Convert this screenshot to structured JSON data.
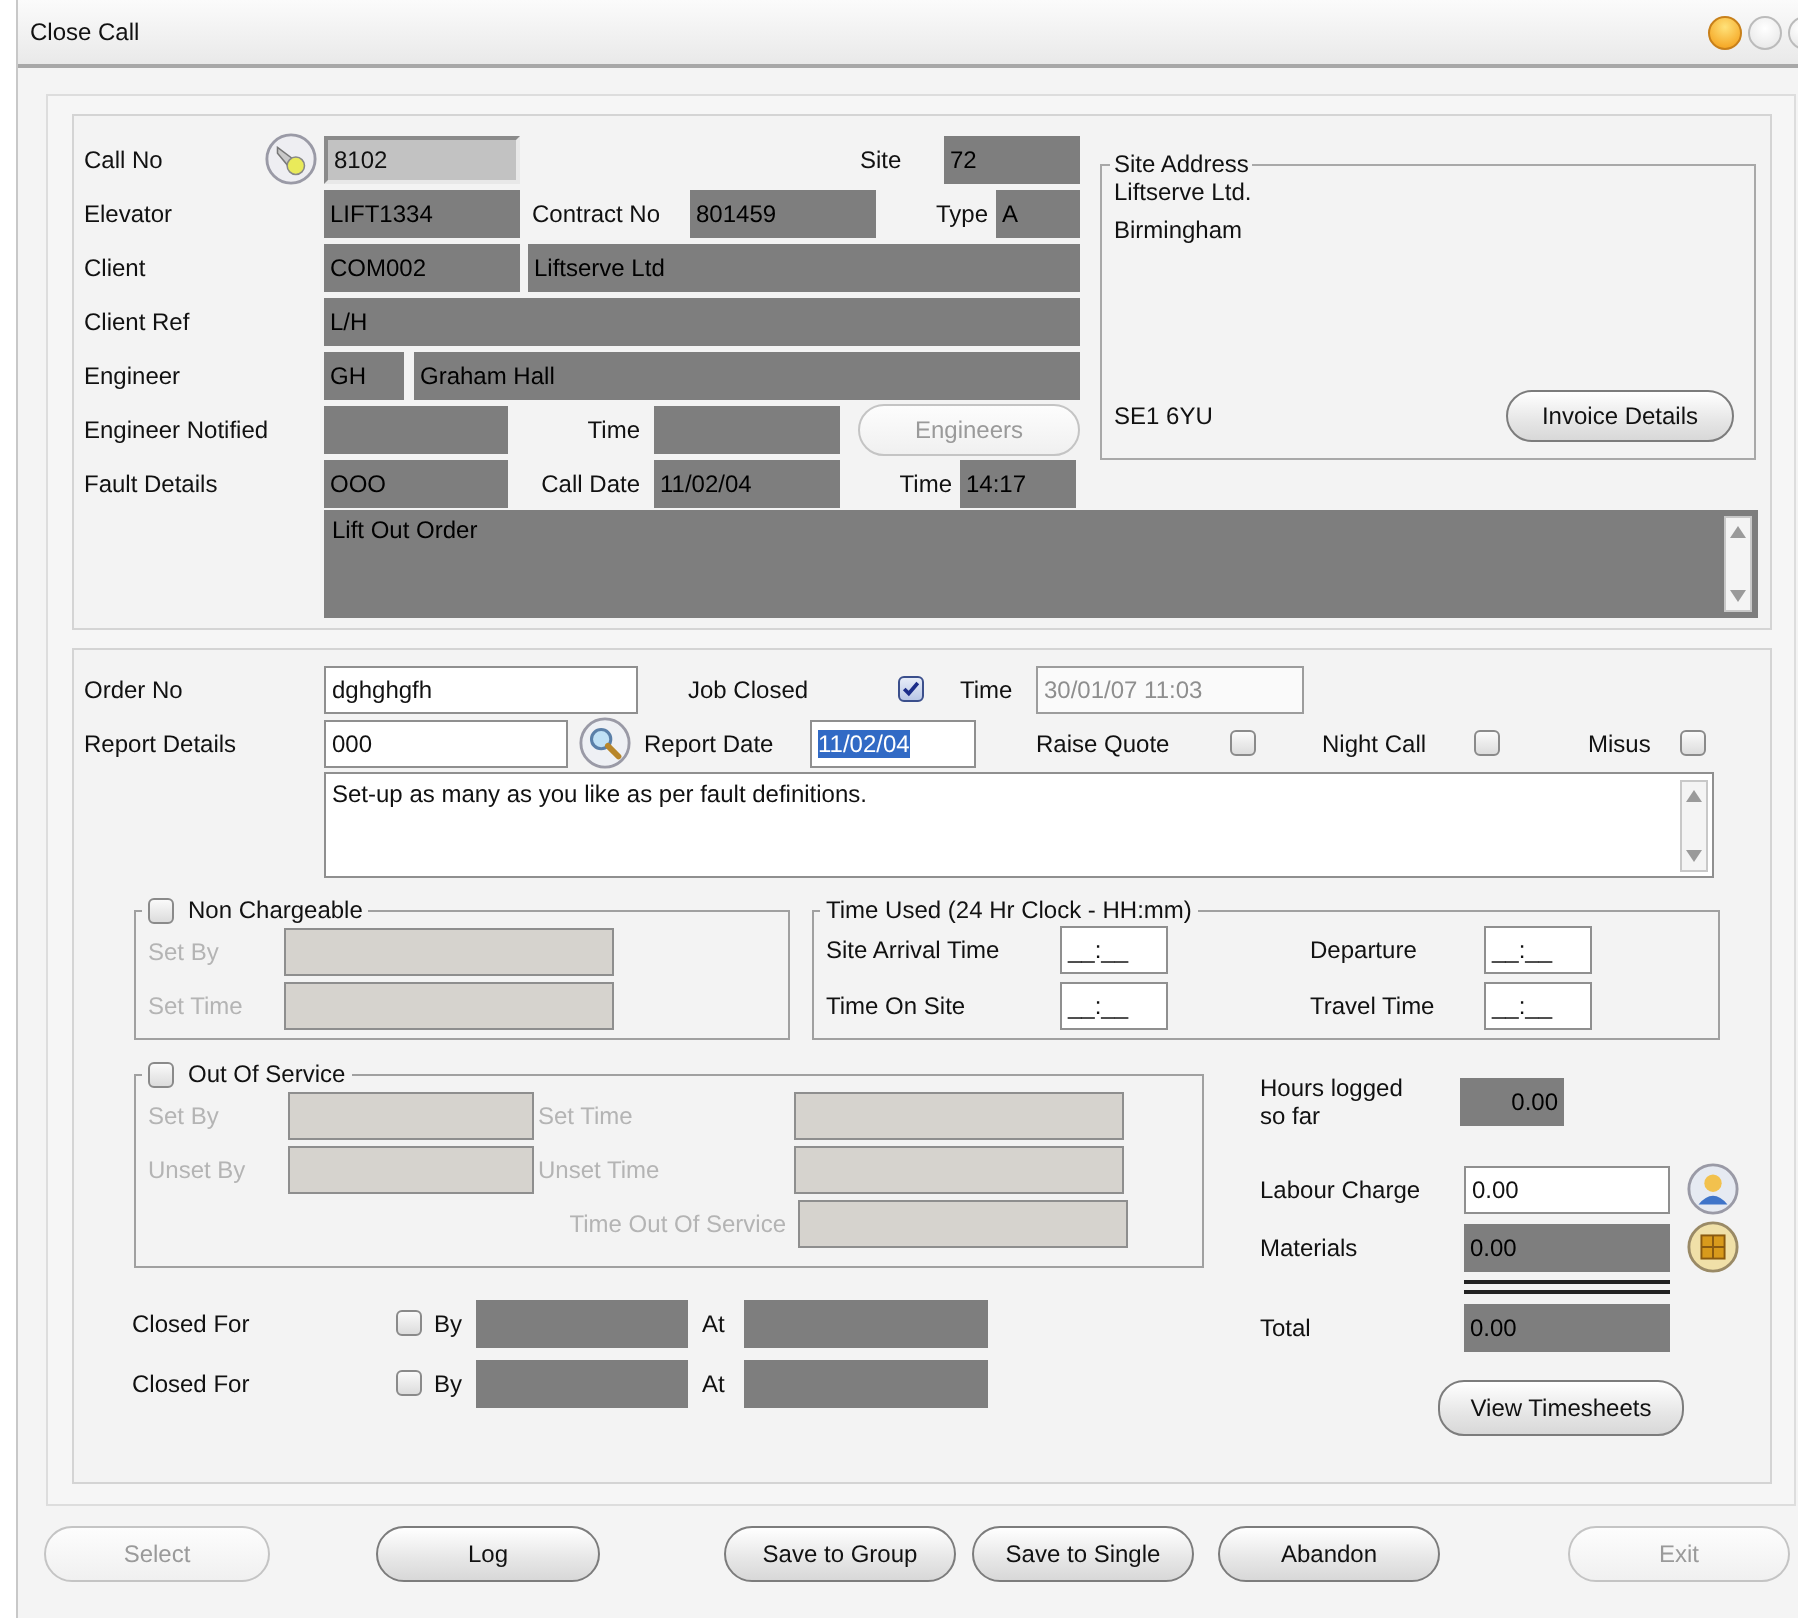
{
  "window": {
    "title": "Close Call"
  },
  "call": {
    "call_no": {
      "label": "Call No",
      "field": {
        "value": "8102",
        "kind": "key"
      }
    },
    "site": {
      "label": "Site",
      "field": {
        "value": "72",
        "kind": "locked"
      }
    },
    "elevator": {
      "label": "Elevator",
      "field": {
        "value": "LIFT1334",
        "kind": "locked"
      }
    },
    "contract_no": {
      "label": "Contract No",
      "field": {
        "value": "801459",
        "kind": "locked"
      }
    },
    "type": {
      "label": "Type",
      "field": {
        "value": "A",
        "kind": "locked"
      }
    },
    "client": {
      "label": "Client",
      "fields": [
        {
          "value": "COM002",
          "kind": "locked"
        },
        {
          "value": "Liftserve Ltd",
          "kind": "locked"
        }
      ]
    },
    "client_ref": {
      "label": "Client Ref",
      "field": {
        "value": "L/H",
        "kind": "locked"
      }
    },
    "engineer": {
      "label": "Engineer",
      "fields": [
        {
          "value": "GH",
          "kind": "locked"
        },
        {
          "value": "Graham Hall",
          "kind": "locked"
        }
      ]
    },
    "engineer_notified": {
      "label": "Engineer Notified",
      "field": {
        "kind": "locked"
      }
    },
    "notified_time": {
      "label": "Time",
      "field": {
        "kind": "locked"
      }
    },
    "engineers_button": {
      "label": "Engineers",
      "disabled": true
    },
    "fault_details": {
      "label": "Fault Details",
      "field": {
        "value": "OOO",
        "kind": "locked"
      }
    },
    "call_date": {
      "label": "Call Date",
      "field": {
        "value": "11/02/04",
        "kind": "locked"
      }
    },
    "call_time": {
      "label": "Time",
      "field": {
        "value": "14:17",
        "kind": "locked"
      }
    },
    "fault_text": {
      "value": "Lift Out Order",
      "kind": "locked"
    },
    "site_address": {
      "title": "Site Address",
      "lines": [
        "Liftserve Ltd.",
        "Birmingham"
      ],
      "postcode": "SE1 6YU",
      "button": {
        "label": "Invoice Details",
        "disabled": false
      }
    }
  },
  "report": {
    "order_no": {
      "label": "Order No",
      "field": {
        "value": "dghghgfh",
        "kind": "input"
      }
    },
    "job_closed": {
      "label": "Job Closed",
      "checked": true
    },
    "closed_time": {
      "label": "Time",
      "field": {
        "value": "30/01/07 11:03",
        "kind": "disabled"
      }
    },
    "report_details": {
      "label": "Report Details",
      "field": {
        "value": "000",
        "kind": "input"
      }
    },
    "report_date": {
      "label": "Report Date",
      "field": {
        "value": "11/02/04",
        "kind": "input",
        "highlighted": true
      }
    },
    "flags": [
      {
        "label": "Raise Quote",
        "checked": false
      },
      {
        "label": "Night Call",
        "checked": false
      },
      {
        "label": "Misus",
        "checked": false
      }
    ],
    "report_text": {
      "value": "Set-up as many as you like as per fault definitions.",
      "kind": "input"
    },
    "non_chargeable": {
      "label": "Non Chargeable",
      "checked": false,
      "disabled": true,
      "rows": [
        "Set By",
        "Set Time"
      ]
    },
    "time_used": {
      "title": "Time Used (24 Hr Clock - HH:mm)",
      "rows": [
        {
          "label": "Site Arrival Time",
          "value": "__:__"
        },
        {
          "label": "Departure",
          "value": "__:__"
        },
        {
          "label": "Time On Site",
          "value": "__:__"
        },
        {
          "label": "Travel Time",
          "value": "__:__"
        }
      ]
    },
    "out_of_service": {
      "label": "Out Of Service",
      "checked": false,
      "disabled": true,
      "rows": [
        "Set By",
        "Set Time",
        "Unset By",
        "Unset Time",
        "Time Out Of Service"
      ]
    },
    "closed_for": [
      {
        "label": "Closed For",
        "checked": false,
        "by": "By",
        "at": "At"
      },
      {
        "label": "Closed For",
        "checked": false,
        "by": "By",
        "at": "At"
      }
    ],
    "costs": {
      "hours": {
        "label": "Hours logged so far",
        "field": {
          "value": "0.00",
          "kind": "locked"
        }
      },
      "labour": {
        "label": "Labour Charge",
        "field": {
          "value": "0.00",
          "kind": "input"
        }
      },
      "materials": {
        "label": "Materials",
        "field": {
          "value": "0.00",
          "kind": "locked"
        }
      },
      "total": {
        "label": "Total",
        "field": {
          "value": "0.00",
          "kind": "locked"
        }
      },
      "timesheets_button": {
        "label": "View Timesheets",
        "disabled": false
      }
    }
  },
  "buttons": [
    {
      "label": "Select",
      "disabled": true
    },
    {
      "label": "Log",
      "disabled": false
    },
    {
      "label": "Save to Group",
      "disabled": false
    },
    {
      "label": "Save to Single",
      "disabled": false
    },
    {
      "label": "Abandon",
      "disabled": false
    },
    {
      "label": "Exit",
      "disabled": true
    }
  ]
}
